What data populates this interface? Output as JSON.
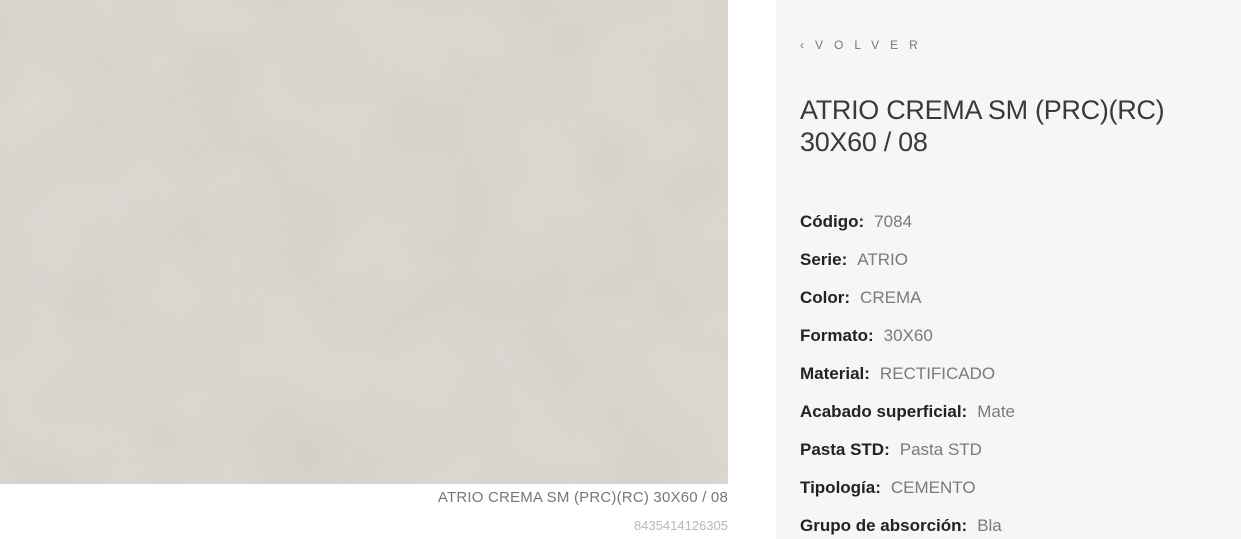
{
  "image": {
    "caption": "ATRIO CREMA SM (PRC)(RC) 30X60 / 08",
    "ean": "8435414126305",
    "tile_color": "#d9d3cc"
  },
  "panel": {
    "back_chevron": "‹",
    "back_label": "VOLVER",
    "title": "ATRIO CREMA SM (PRC)(RC) 30X60 / 08",
    "specs": [
      {
        "label": "Código:",
        "value": "7084"
      },
      {
        "label": "Serie:",
        "value": "ATRIO"
      },
      {
        "label": "Color:",
        "value": "CREMA"
      },
      {
        "label": "Formato:",
        "value": "30X60"
      },
      {
        "label": "Material:",
        "value": "RECTIFICADO"
      },
      {
        "label": "Acabado superficial:",
        "value": "Mate"
      },
      {
        "label": "Pasta STD:",
        "value": "Pasta STD"
      },
      {
        "label": "Tipología:",
        "value": "CEMENTO"
      },
      {
        "label": "Grupo de absorción:",
        "value": "Bla"
      }
    ]
  }
}
